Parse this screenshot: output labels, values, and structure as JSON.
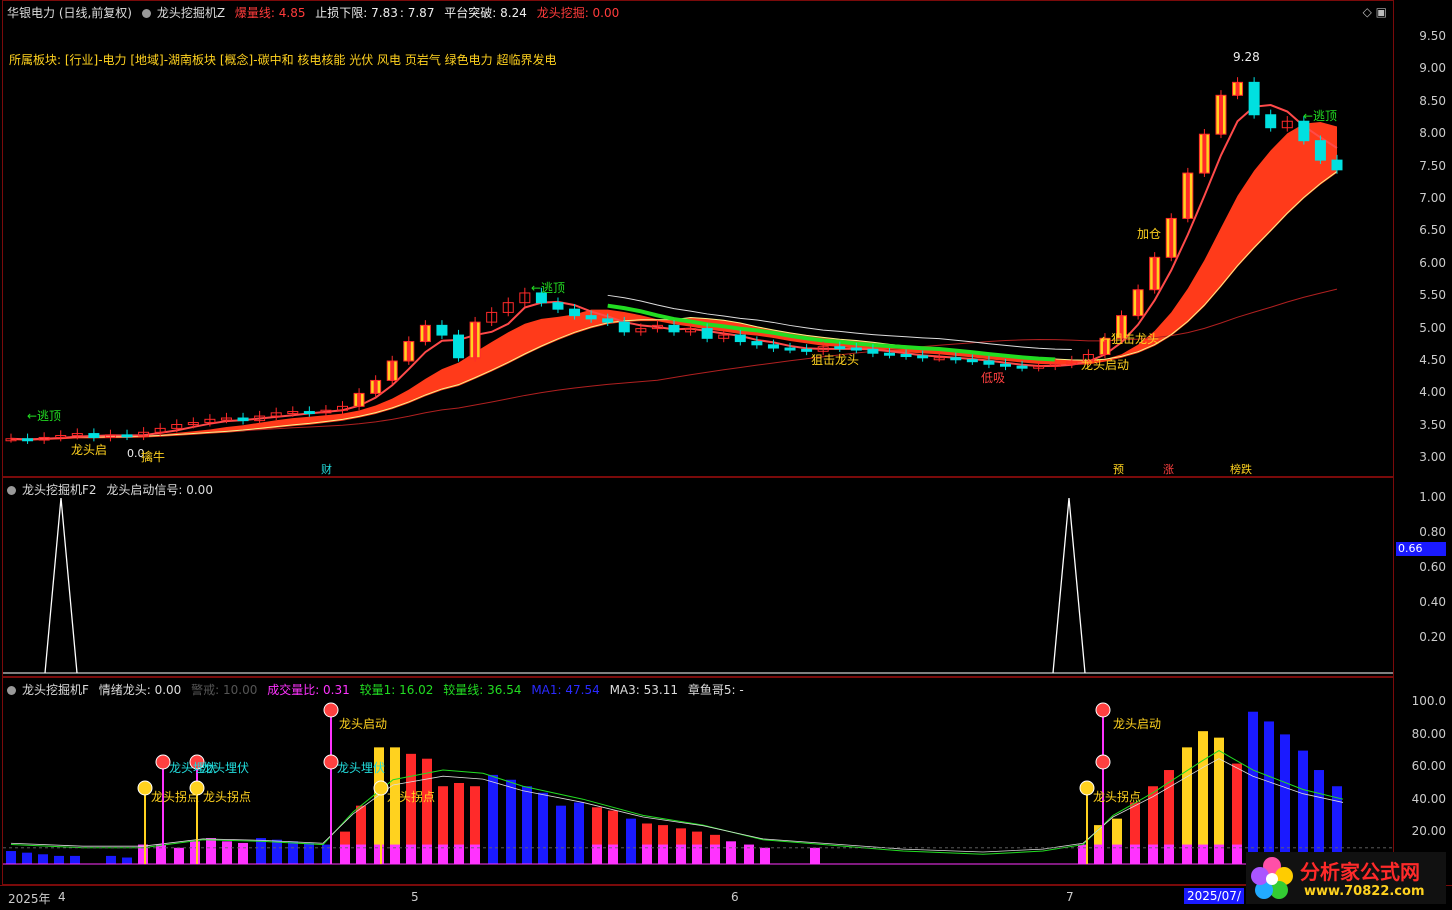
{
  "main_header": {
    "title": "华银电力 (日线,前复权)",
    "indicator": "龙头挖掘机Z",
    "bao": "爆量线: 4.85",
    "stop": "止损下限: 7.83",
    "stop2": ": 7.87",
    "break": "平台突破: 8.24",
    "dig": "龙头挖掘: 0.00"
  },
  "sector": "所属板块: [行业]-电力 [地域]-湖南板块 [概念]-碳中和 核电核能 光伏 风电 页岩气 绿色电力 超临界发电",
  "annotations": {
    "escape1": "←逃顶",
    "escape2": "←逃顶",
    "escape3": "←逃顶",
    "dragon_start": "龙头启",
    "bull": "擒牛",
    "zero": "0.0",
    "snipe1": "狙击龙头",
    "snipe2": "←狙击龙头",
    "low_buy": "低吸",
    "dragon_launch": "龙头启动",
    "add": "加仓",
    "high": "9.28",
    "cai": "财",
    "yu": "预",
    "zhang": "涨",
    "bang": "榜跌"
  },
  "main_axis": [
    "9.50",
    "9.00",
    "8.50",
    "8.00",
    "7.50",
    "7.00",
    "6.50",
    "6.00",
    "5.50",
    "5.00",
    "4.50",
    "4.00",
    "3.50",
    "3.00"
  ],
  "f2_header": {
    "name": "龙头挖掘机F2",
    "signal": "龙头启动信号: 0.00"
  },
  "f2_axis": [
    "1.00",
    "0.80",
    "0.60",
    "0.40",
    "0.20"
  ],
  "f2_marker": "0.66",
  "f_header": {
    "name": "龙头挖掘机F",
    "mood": "情绪龙头: 0.00",
    "warn": "警戒: 10.00",
    "volratio": "成交量比: 0.31",
    "cmp1": "较量1: 16.02",
    "cmpline": "较量线: 36.54",
    "ma1": "MA1: 47.54",
    "ma3": "MA3: 53.11",
    "octo": "章鱼哥5: -"
  },
  "f_axis": [
    "100.0",
    "80.00",
    "60.00",
    "40.00",
    "20.00"
  ],
  "f_labels": {
    "ambush1": "龙头埋伏",
    "ambush2": "龙头埋伏",
    "ambush3": "龙头埋伏",
    "turn1": "龙头拐点",
    "turn2": "龙头拐点",
    "turn3": "龙头拐点",
    "turn4": "龙头拐点",
    "launch1": "龙头启动",
    "launch2": "龙头启动"
  },
  "dates": [
    "2025年",
    "4",
    "5",
    "6",
    "7",
    "2025/07/"
  ],
  "logo": {
    "text": "分析家公式网",
    "url": "www.70822.com"
  },
  "colors": {
    "up": "#ff2a2a",
    "down": "#00e0e0",
    "green": "#22dd22",
    "yellow": "#ffd21f",
    "magenta": "#ff33ff",
    "blue": "#1a1aff"
  }
}
